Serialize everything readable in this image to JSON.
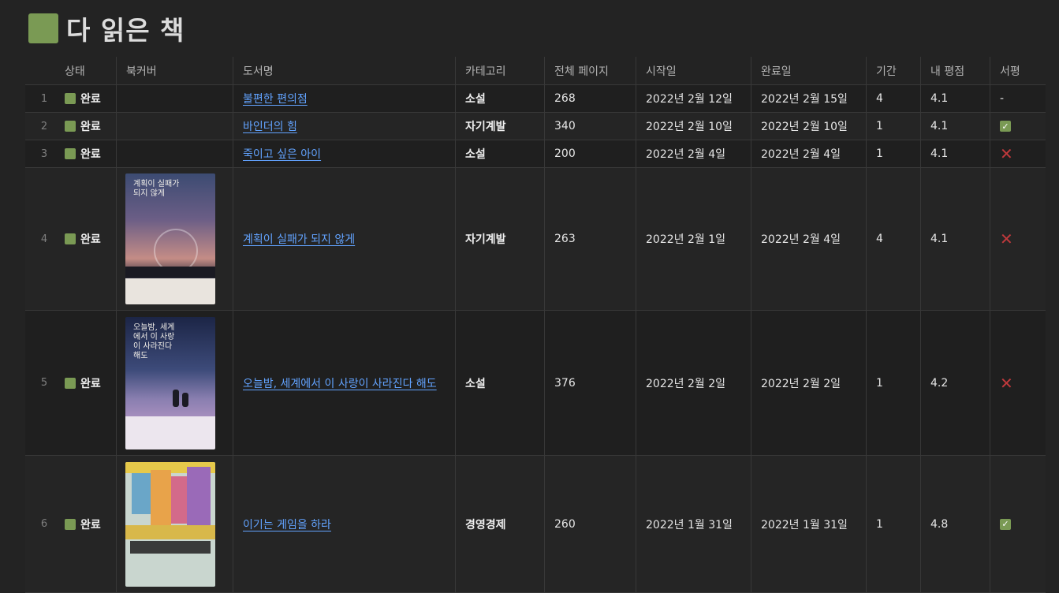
{
  "page": {
    "title": "다 읽은 책"
  },
  "table": {
    "headers": {
      "status": "상태",
      "cover": "북커버",
      "title": "도서명",
      "category": "카테고리",
      "pages": "전체 페이지",
      "start": "시작일",
      "end": "완료일",
      "duration": "기간",
      "rating": "내 평점",
      "review": "서평"
    },
    "rows": [
      {
        "num": "1",
        "status": "완료",
        "title": "불편한 편의점",
        "category": "소설",
        "pages": "268",
        "start": "2022년 2월 12일",
        "end": "2022년 2월 15일",
        "duration": "4",
        "rating": "4.1",
        "review": "-",
        "cover": ""
      },
      {
        "num": "2",
        "status": "완료",
        "title": "바인더의 힘",
        "category": "자기계발",
        "pages": "340",
        "start": "2022년 2월 10일",
        "end": "2022년 2월 10일",
        "duration": "1",
        "rating": "4.1",
        "review": "✓",
        "cover": ""
      },
      {
        "num": "3",
        "status": "완료",
        "title": "죽이고 싶은 아이",
        "category": "소설",
        "pages": "200",
        "start": "2022년 2월 4일",
        "end": "2022년 2월 4일",
        "duration": "1",
        "rating": "4.1",
        "review": "✕",
        "cover": ""
      },
      {
        "num": "4",
        "status": "완료",
        "title": "계획이 실패가 되지 않게",
        "category": "자기계발",
        "pages": "263",
        "start": "2022년 2월 1일",
        "end": "2022년 2월 4일",
        "duration": "4",
        "rating": "4.1",
        "review": "✕",
        "cover": "계획이 실패가 되지 않게"
      },
      {
        "num": "5",
        "status": "완료",
        "title": "오늘밤, 세계에서 이 사랑이 사라진다 해도",
        "category": "소설",
        "pages": "376",
        "start": "2022년 2월 2일",
        "end": "2022년 2월 2일",
        "duration": "1",
        "rating": "4.2",
        "review": "✕",
        "cover": "오늘밤, 세계에서 이 사랑이 사라진다 해도"
      },
      {
        "num": "6",
        "status": "완료",
        "title": "이기는 게임을 하라",
        "category": "경영경제",
        "pages": "260",
        "start": "2022년 1월 31일",
        "end": "2022년 1월 31일",
        "duration": "1",
        "rating": "4.8",
        "review": "✓",
        "cover": ""
      }
    ]
  },
  "colors": {
    "status_green": "#7a9a54",
    "link_blue": "#62a3ff",
    "cross_red": "#c0393c"
  },
  "icons": {
    "status": "green-square-icon",
    "check": "check-icon",
    "cross": "cross-icon"
  }
}
